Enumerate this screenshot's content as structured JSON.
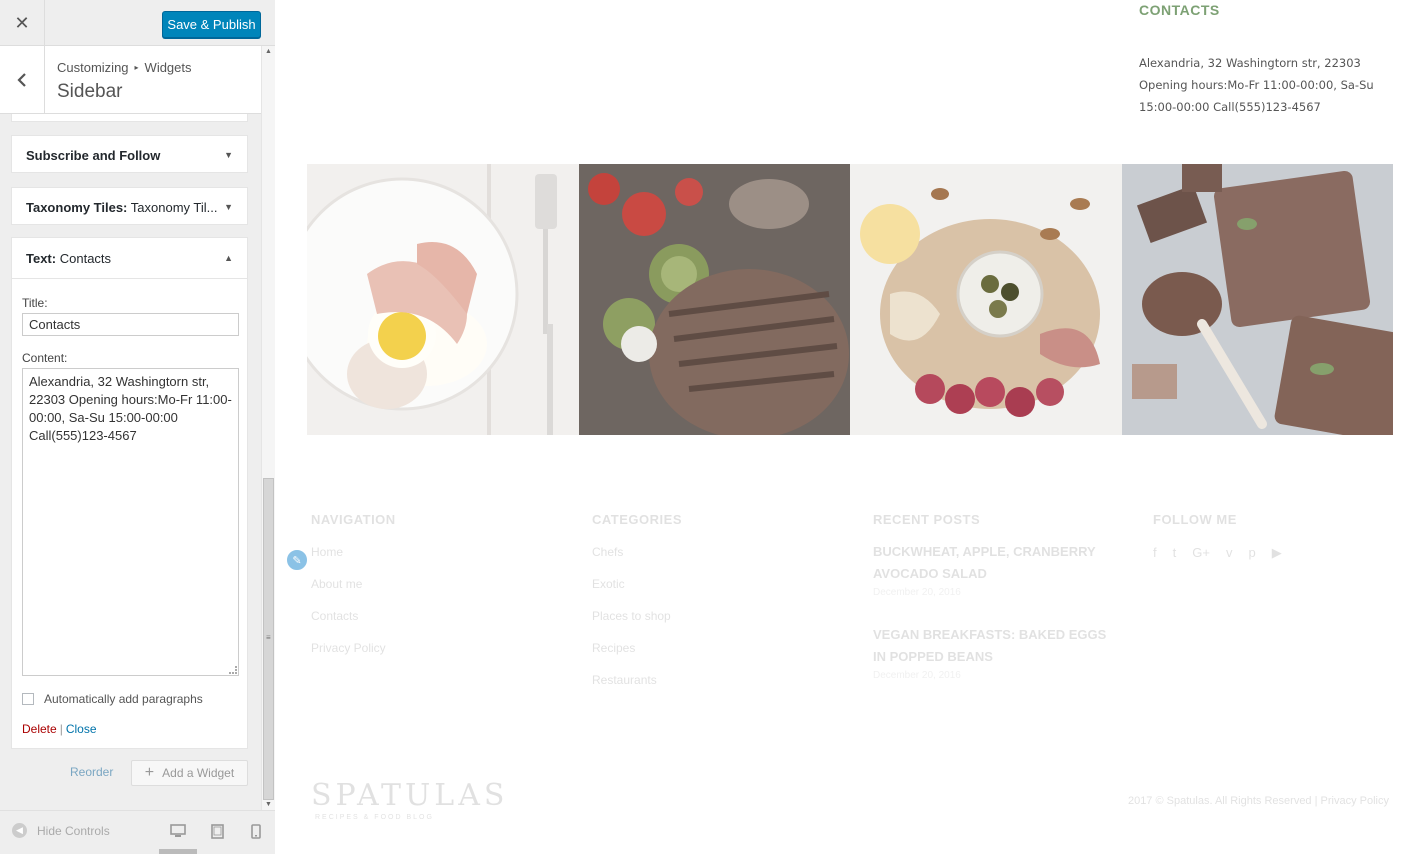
{
  "customizer": {
    "close_glyph": "✕",
    "save_label": "Save & Publish",
    "back_glyph": "‹",
    "breadcrumb": {
      "root": "Customizing",
      "sep": "▸",
      "current": "Widgets"
    },
    "section_title": "Sidebar",
    "widgets": [
      {
        "name": "Subscribe and Follow",
        "subtitle": ""
      },
      {
        "name": "Taxonomy Tiles:",
        "subtitle": "Taxonomy Til..."
      },
      {
        "name": "Text:",
        "subtitle": "Contacts"
      }
    ],
    "text_widget": {
      "title_label": "Title:",
      "title_value": "Contacts",
      "content_label": "Content:",
      "content_value": "Alexandria, 32 Washingtorn str, 22303 Opening hours:Mo-Fr 11:00-00:00, Sa-Su 15:00-00:00 Call(555)123-4567",
      "auto_paragraphs_label": "Automatically add paragraphs",
      "auto_paragraphs_checked": false,
      "delete_label": "Delete",
      "separator": "|",
      "close_label": "Close"
    },
    "reorder_label": "Reorder",
    "add_widget_label": "Add a Widget",
    "hide_controls_label": "Hide Controls",
    "accent_color": "#0085ba"
  },
  "preview": {
    "contacts_heading": "CONTACTS",
    "contacts_text": "Alexandria, 32 Washingtorn str, 22303 Opening hours:Mo-Fr 11:00-00:00, Sa-Su 15:00-00:00 Call(555)123-4567",
    "heading_color": "#7da174",
    "navigation": {
      "title": "NAVIGATION",
      "links": [
        "Home",
        "About me",
        "Contacts",
        "Privacy Policy"
      ]
    },
    "categories": {
      "title": "CATEGORIES",
      "links": [
        "Chefs",
        "Exotic",
        "Places to shop",
        "Recipes",
        "Restaurants"
      ]
    },
    "recent_posts": {
      "title": "RECENT POSTS",
      "posts": [
        {
          "title": "BUCKWHEAT, APPLE, CRANBERRY AVOCADO SALAD",
          "date": "December 20, 2016"
        },
        {
          "title": "VEGAN BREAKFASTS: BAKED EGGS IN POPPED BEANS",
          "date": "December 20, 2016"
        }
      ]
    },
    "follow_me": {
      "title": "FOLLOW ME",
      "icons": [
        "facebook-icon",
        "twitter-icon",
        "google-plus-icon",
        "vimeo-icon",
        "pinterest-icon",
        "youtube-icon"
      ]
    },
    "logo": "SPATULAS",
    "logo_sub": "RECIPES & FOOD BLOG",
    "copyright": "2017 © Spatulas. All Rights Reserved |",
    "privacy_link": "Privacy Policy"
  }
}
